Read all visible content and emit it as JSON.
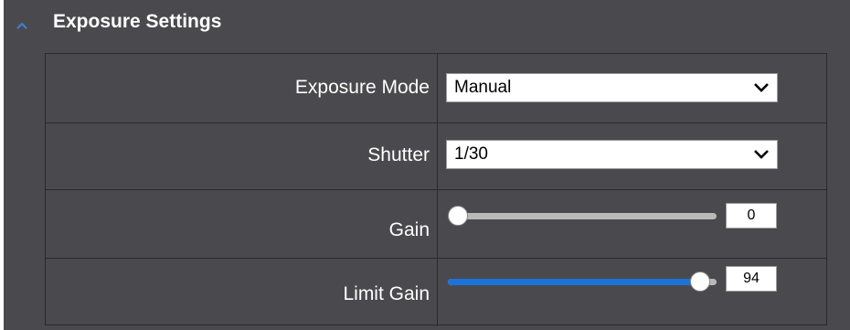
{
  "panel": {
    "title": "Exposure Settings",
    "collapse_icon": "chevron-up-icon"
  },
  "rows": [
    {
      "label": "Exposure Mode",
      "control": "select",
      "value": "Manual",
      "icon": "chevron-down-icon"
    },
    {
      "label": "Shutter",
      "control": "select",
      "value": "1/30",
      "icon": "chevron-down-icon"
    },
    {
      "label": "Gain",
      "control": "slider",
      "value": "0",
      "level_percent": 0
    },
    {
      "label": "Limit Gain",
      "control": "slider",
      "value": "94",
      "level_percent": 94
    }
  ],
  "colors": {
    "panel_bg": "#4a4a4e",
    "accent": "#1a73d9",
    "track": "#b9b9b9",
    "collapse_icon": "#3d7fd1"
  }
}
